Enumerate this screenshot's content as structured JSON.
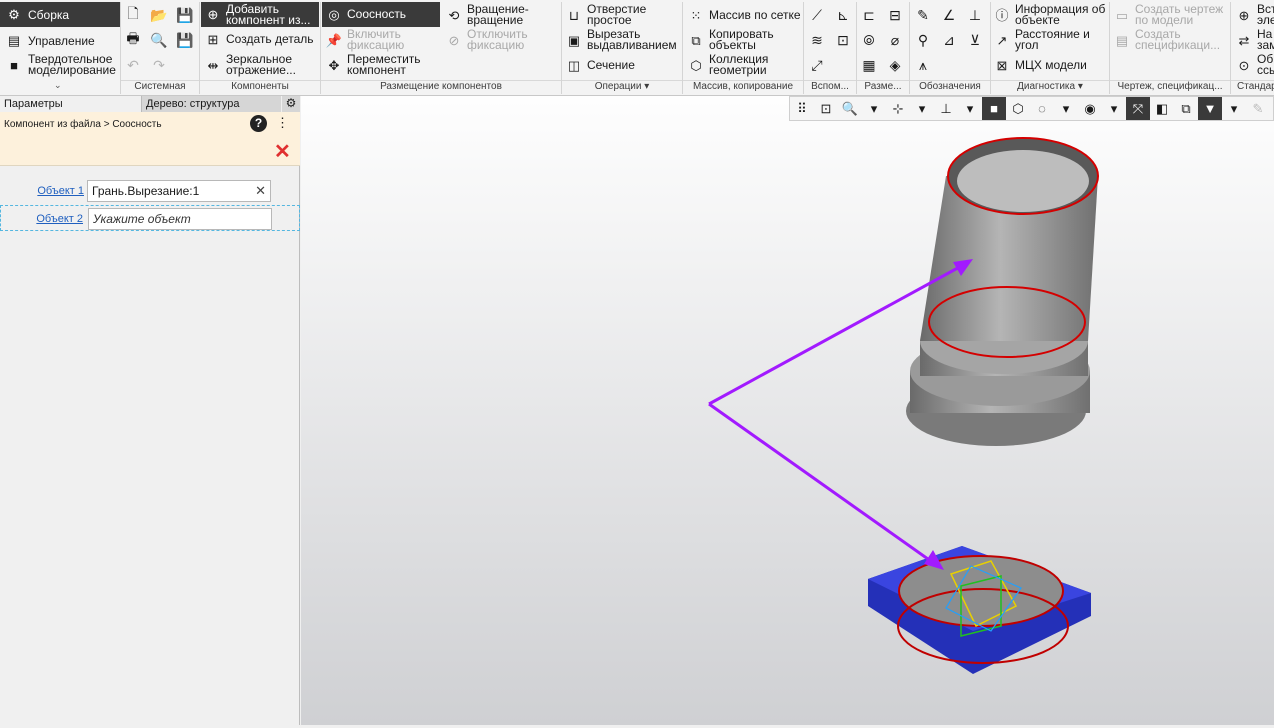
{
  "ribbon": {
    "modes": [
      "Сборка",
      "Управление",
      "Твердотельное\nмоделирование"
    ],
    "add_component": "Добавить\nкомпонент из...",
    "create_part": "Создать деталь",
    "mirror": "Зеркальное\nотражение...",
    "coaxial": "Соосность",
    "enable_fix": "Включить\nфиксацию",
    "move_component": "Переместить\nкомпонент",
    "rotate": "Вращение-\nвращение",
    "disable_fix": "Отключить\nфиксацию",
    "simple_hole": "Отверстие\nпростое",
    "extrude_cut": "Вырезать\nвыдавливанием",
    "section": "Сечение",
    "grid_array": "Массив по сетке",
    "copy_objects": "Копировать\nобъекты",
    "geometry_collection": "Коллекция\nгеометрии",
    "object_info": "Информация об\nобъекте",
    "distance_angle": "Расстояние и\nугол",
    "mass_props": "МЦХ модели",
    "create_drawing": "Создать чертеж\nпо модели",
    "create_spec": "Создать\nспецификаци...",
    "cut_right_1": "Вст\nэле",
    "cut_right_2": "На\nзам",
    "cut_right_3": "Об\nссы",
    "groups": {
      "system": "Системная",
      "components": "Компоненты",
      "placement": "Размещение компонентов",
      "operations": "Операции",
      "arrays": "Массив, копирование",
      "aux": "Вспом...",
      "dims": "Разме...",
      "annotations": "Обозначения",
      "diagnostics": "Диагностика",
      "drawing": "Чертеж, спецификац...",
      "standard": "Стандар"
    }
  },
  "panel": {
    "tab_params": "Параметры",
    "tab_tree": "Дерево: структура",
    "breadcrumb": "Компонент из файла > Соосность",
    "object1_label": "Объект 1",
    "object1_value": "Грань.Вырезание:1",
    "object2_label": "Объект 2",
    "object2_placeholder": "Укажите объект"
  },
  "colors": {
    "accent_dark": "#3a3a3a",
    "arrow": "#a21aff",
    "highlight": "#d40000",
    "fan": "#2a2ad0",
    "pipe": "#8c8c8c"
  }
}
